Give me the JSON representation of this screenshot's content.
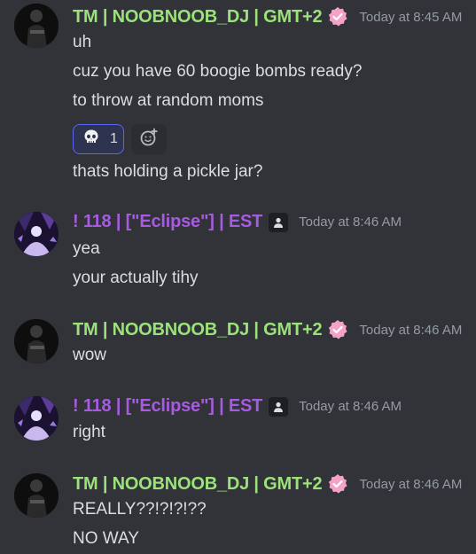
{
  "messages": [
    {
      "user": "TM | NOOBNOOB_DJ | GMT+2",
      "time": "Today at 8:45 AM",
      "lines": [
        "uh",
        "cuz you have 60 boogie bombs ready?",
        "to throw at random moms",
        "thats holding a pickle jar?"
      ],
      "reaction": {
        "emoji": "skull-icon",
        "count": "1"
      }
    },
    {
      "user": "! 118 | [\"Eclipse\"] | EST",
      "time": "Today at 8:46 AM",
      "lines": [
        "yea",
        "your actually tihy"
      ]
    },
    {
      "user": "TM | NOOBNOOB_DJ | GMT+2",
      "time": "Today at 8:46 AM",
      "lines": [
        "wow"
      ]
    },
    {
      "user": "! 118 | [\"Eclipse\"] | EST",
      "time": "Today at 8:46 AM",
      "lines": [
        "right"
      ]
    },
    {
      "user": "TM | NOOBNOOB_DJ | GMT+2",
      "time": "Today at 8:46 AM",
      "lines": [
        "REALLY??!?!?!??",
        "NO WAY"
      ]
    }
  ],
  "colors": {
    "background": "#313338",
    "tm_name": "#9be27a",
    "eclipse_name": "#a65be0",
    "reaction_border": "#5865f2"
  },
  "icons": {
    "verified_badge": "verified-badge-icon",
    "bot_badge": "person-badge-icon",
    "add_reaction": "add-reaction-icon"
  }
}
